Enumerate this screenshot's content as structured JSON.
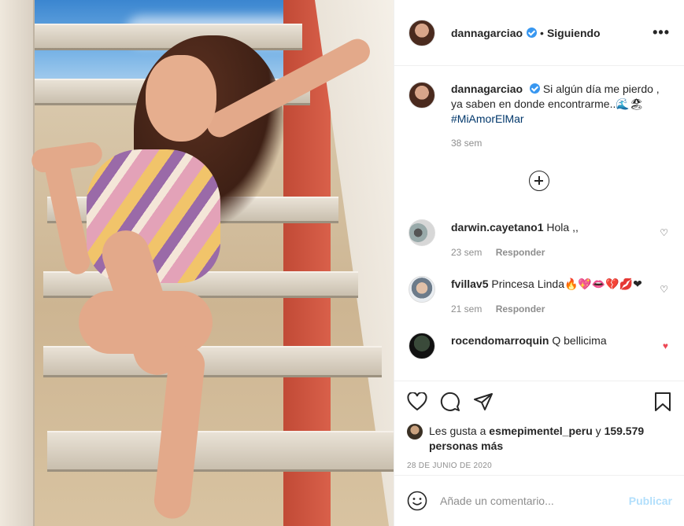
{
  "post": {
    "username": "dannagarciao",
    "follow_status": "Siguiendo",
    "separator": "•",
    "more_icon": "more-horizontal-icon"
  },
  "caption": {
    "username": "dannagarciao",
    "text": "Si algún día me pierdo , ya saben en donde encontrarme..",
    "emojis": "🌊🏖",
    "hashtag": "#MiAmorElMar",
    "age": "38 sem"
  },
  "comments": [
    {
      "username": "darwin.cayetano1",
      "text": "Hola ,,",
      "age": "23 sem",
      "reply": "Responder",
      "liked": false
    },
    {
      "username": "fvillav5",
      "text": "Princesa Linda🔥💖👄💔💋❤",
      "age": "21 sem",
      "reply": "Responder",
      "liked": false
    },
    {
      "username": "rocendomarroquin",
      "text": "Q bellicima",
      "age": "",
      "reply": "",
      "liked": true
    }
  ],
  "likes": {
    "prefix": "Les gusta a",
    "user": "esmepimentel_peru",
    "connector": "y",
    "count": "159.579 personas más"
  },
  "date": "28 DE JUNIO DE 2020",
  "add_comment": {
    "placeholder": "Añade un comentario...",
    "post_label": "Publicar"
  },
  "colors": {
    "verified": "#3897f0",
    "hashtag": "#00376b",
    "liked_heart": "#ed4956",
    "post_disabled": "#b2dffc",
    "meta_gray": "#8e8e8e"
  }
}
